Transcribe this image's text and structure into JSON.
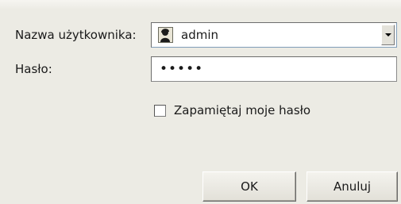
{
  "form": {
    "username_label": "Nazwa użytkownika:",
    "username_value": "admin",
    "user_icon": "user-silhouette-icon",
    "password_label": "Hasło:",
    "password_value": "•••••",
    "remember_label": "Zapamiętaj moje hasło",
    "remember_checked": false
  },
  "buttons": {
    "ok_label": "OK",
    "cancel_label": "Anuluj"
  },
  "colors": {
    "dialog_bg": "#ecebe4",
    "field_border": "#7f9db9"
  }
}
